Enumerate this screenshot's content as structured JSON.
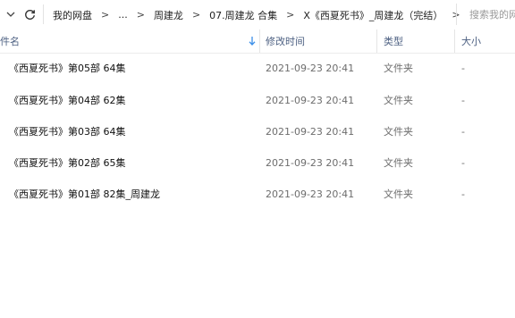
{
  "address_bar": {
    "breadcrumbs": [
      "我的网盘",
      "...",
      "周建龙",
      "07.周建龙 合集",
      "X《西夏死书》_周建龙（完结）"
    ],
    "separator": ">",
    "search_placeholder": "搜索我的网盘"
  },
  "columns": {
    "name": "件名",
    "modified": "修改时间",
    "type": "类型",
    "size": "大小"
  },
  "rows": [
    {
      "name": "《西夏死书》第05部 64集",
      "modified": "2021-09-23 20:41",
      "type": "文件夹",
      "size": "-"
    },
    {
      "name": "《西夏死书》第04部 62集",
      "modified": "2021-09-23 20:41",
      "type": "文件夹",
      "size": "-"
    },
    {
      "name": "《西夏死书》第03部 64集",
      "modified": "2021-09-23 20:41",
      "type": "文件夹",
      "size": "-"
    },
    {
      "name": "《西夏死书》第02部 65集",
      "modified": "2021-09-23 20:41",
      "type": "文件夹",
      "size": "-"
    },
    {
      "name": "《西夏死书》第01部 82集_周建龙",
      "modified": "2021-09-23 20:41",
      "type": "文件夹",
      "size": "-"
    }
  ],
  "colors": {
    "header_text": "#4d6082",
    "sort_accent": "#3b8fe8",
    "muted_text": "#6d6d6d"
  }
}
